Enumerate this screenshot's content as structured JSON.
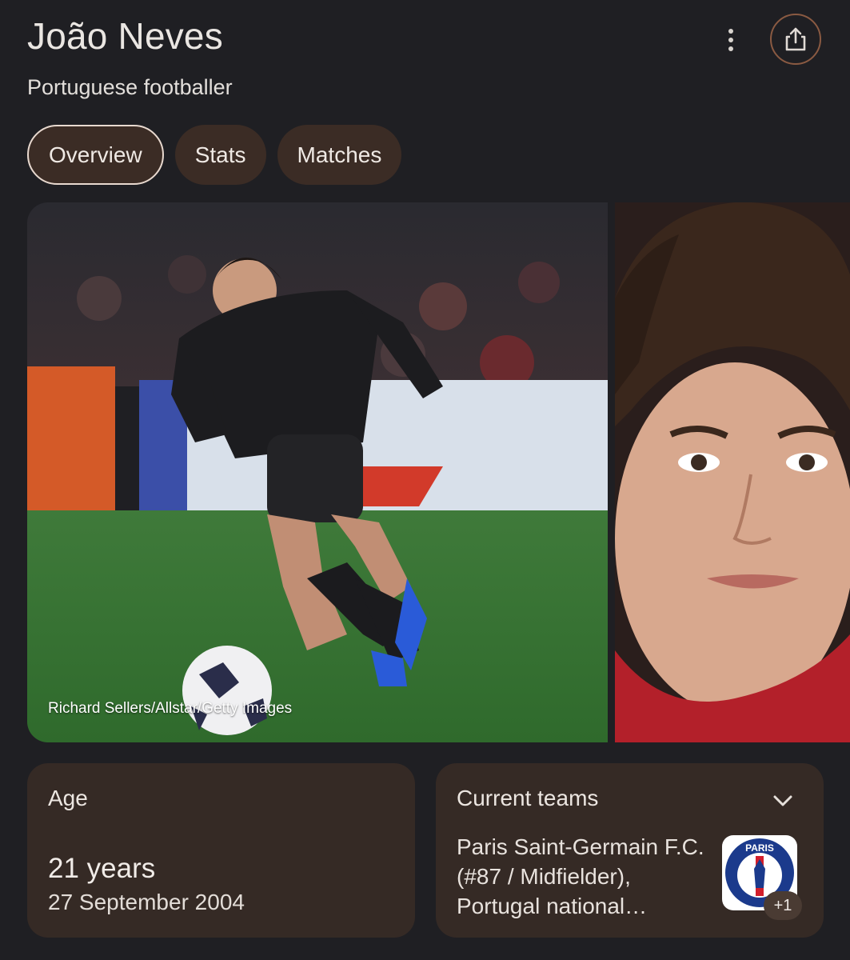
{
  "header": {
    "title": "João Neves",
    "subtitle": "Portuguese footballer",
    "more_icon": "more-vert-icon",
    "share_icon": "share-icon"
  },
  "tabs": [
    {
      "label": "Overview",
      "active": true
    },
    {
      "label": "Stats",
      "active": false
    },
    {
      "label": "Matches",
      "active": false
    }
  ],
  "gallery": {
    "credit": "Richard Sellers/Allstar/Getty Images"
  },
  "age_card": {
    "label": "Age",
    "value": "21 years",
    "date": "27 September 2004"
  },
  "teams_card": {
    "label": "Current teams",
    "text": "Paris Saint-Germain F.C. (#87 / Midfielder), Portugal national…",
    "badge": "+1",
    "logo_text": "PARIS"
  },
  "colors": {
    "background": "#1f1f23",
    "card": "#352a25",
    "tab": "#3b2c25",
    "accent_border": "#8a5a42"
  }
}
